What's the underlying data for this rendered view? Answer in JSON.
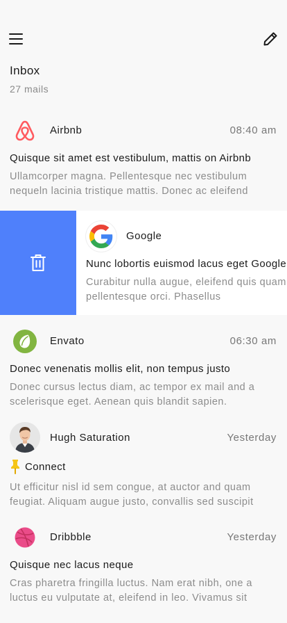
{
  "header": {
    "title": "Inbox",
    "count": "27 mails",
    "menu_icon": "hamburger-menu-icon",
    "compose_icon": "pencil-icon"
  },
  "mails": [
    {
      "sender": "Airbnb",
      "time": "08:40 am",
      "subject": "Quisque sit amet est vestibulum, mattis on Airbnb",
      "preview": "Ullamcorper magna. Pellentesque nec vestibulum nequeln lacinia tristique mattis. Donec ac eleifend",
      "icon": "airbnb-logo-icon",
      "color": "#ff5a5f"
    },
    {
      "sender": "Google",
      "subject": "Nunc lobortis euismod lacus eget Google",
      "preview": "Curabitur nulla augue, eleifend quis quam hendrerit pellentesque orci. Phasellus",
      "icon": "google-logo-icon"
    },
    {
      "sender": "Envato",
      "time": "06:30 am",
      "subject": "Donec venenatis mollis elit, non tempus justo",
      "preview": "Donec cursus lectus diam, ac tempor ex mail and a scelerisque eget. Aenean quis blandit sapien.",
      "icon": "envato-logo-icon",
      "color": "#82b541"
    },
    {
      "sender": "Hugh Saturation",
      "time": "Yesterday",
      "subject": "Connect",
      "preview": "Ut efficitur nisl id sem congue, at auctor and quam feugiat. Aliquam augue justo, convallis sed suscipit",
      "icon": "pushpin-icon",
      "color": "#f5c518"
    },
    {
      "sender": "Dribbble",
      "time": "Yesterday",
      "subject": "Quisque nec lacus neque",
      "preview": "Cras pharetra fringilla luctus. Nam erat nibh, one a luctus eu vulputate at, eleifend in leo. Vivamus sit",
      "icon": "dribbble-logo-icon",
      "color": "#ea4c89"
    }
  ],
  "swipe_action": {
    "icon": "trash-icon",
    "color": "#4f80fb"
  }
}
